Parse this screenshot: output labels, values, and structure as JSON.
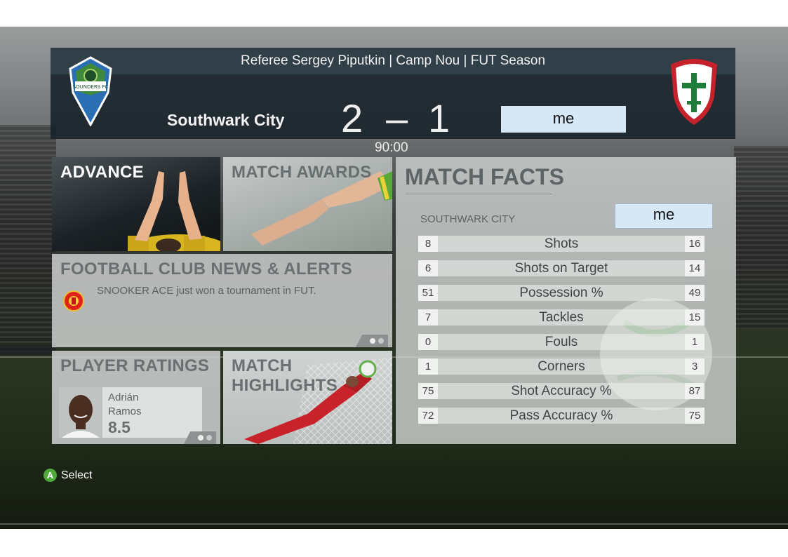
{
  "scoreboard": {
    "info": "Referee Sergey Piputkin | Camp Nou | FUT Season",
    "home_team": "Southwark City",
    "home_score": "2",
    "separator": "–",
    "away_score": "1",
    "clock": "90:00",
    "away_team": "me",
    "home_crest_text": "SOUNDERS FC",
    "away_crest_icon": "cross-shield-icon"
  },
  "tiles": {
    "advance": "ADVANCE",
    "match_awards": "MATCH AWARDS",
    "news": {
      "title": "FOOTBALL CLUB NEWS & ALERTS",
      "message": "SNOOKER ACE just won a tournament in FUT."
    },
    "player_ratings": {
      "title": "PLAYER RATINGS",
      "first_name": "Adrián",
      "last_name": "Ramos",
      "rating": "8.5"
    },
    "match_highlights": {
      "line1": "MATCH",
      "line2": "HIGHLIGHTS"
    }
  },
  "match_facts": {
    "title": "MATCH FACTS",
    "home_label": "SOUTHWARK CITY",
    "away_label": "me",
    "stats": [
      {
        "label": "Shots",
        "home": "8",
        "away": "16"
      },
      {
        "label": "Shots on Target",
        "home": "6",
        "away": "14"
      },
      {
        "label": "Possession %",
        "home": "51",
        "away": "49"
      },
      {
        "label": "Tackles",
        "home": "7",
        "away": "15"
      },
      {
        "label": "Fouls",
        "home": "0",
        "away": "1"
      },
      {
        "label": "Corners",
        "home": "1",
        "away": "3"
      },
      {
        "label": "Shot Accuracy %",
        "home": "75",
        "away": "87"
      },
      {
        "label": "Pass Accuracy %",
        "home": "72",
        "away": "75"
      }
    ]
  },
  "footer": {
    "button_glyph": "A",
    "select_label": "Select"
  },
  "colors": {
    "a_button": "#4faa3a",
    "away_box": "#d6e8f6",
    "scoreboard": "#162028"
  }
}
